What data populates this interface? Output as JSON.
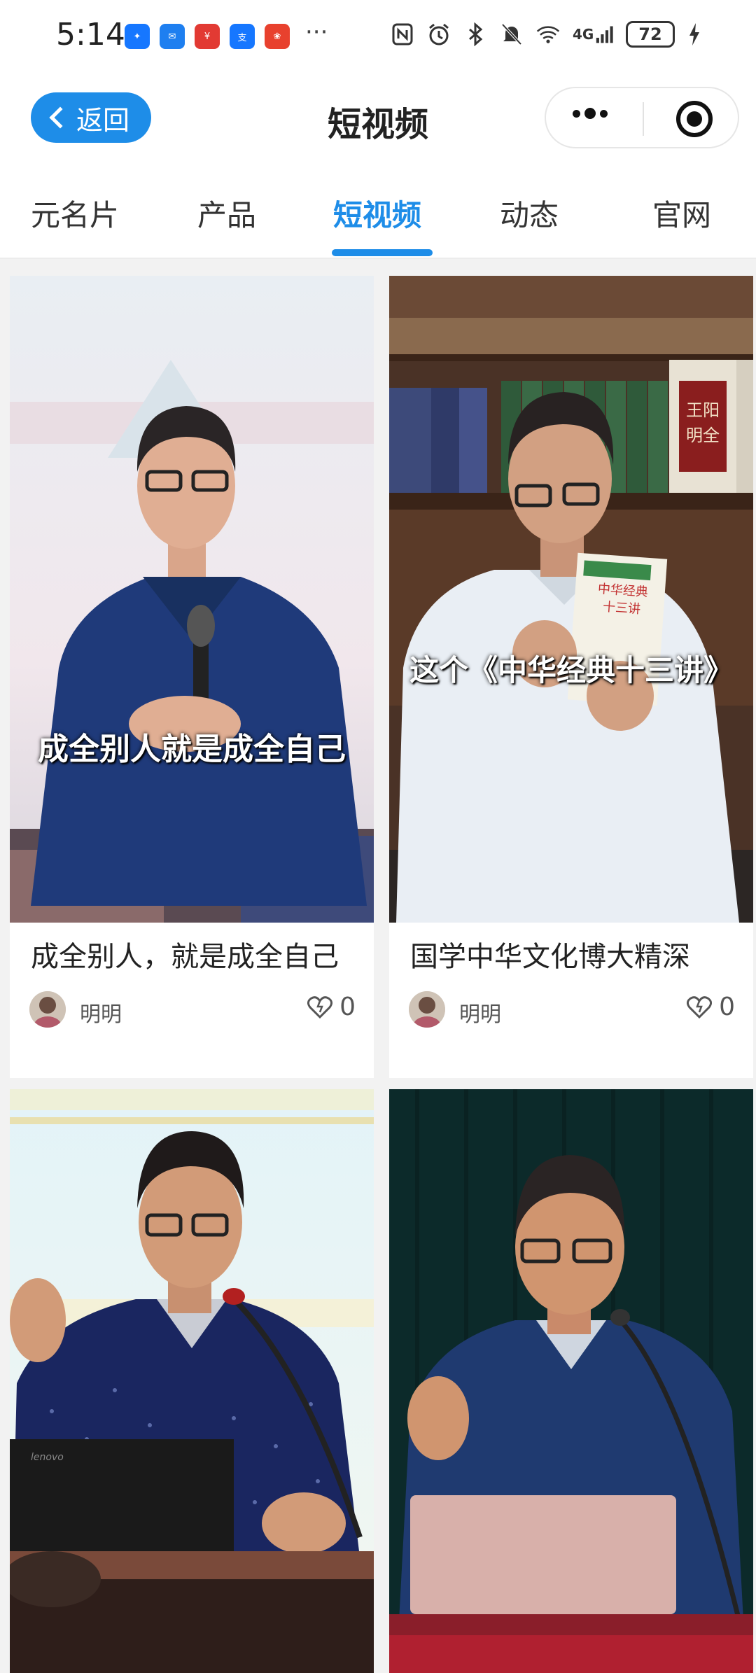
{
  "status_bar": {
    "time": "5:14",
    "apps": [
      {
        "icon": "message-app-icon",
        "color": "#1677ff"
      },
      {
        "icon": "mail-app-icon",
        "color": "#1e7ff0"
      },
      {
        "icon": "yunshanfu-app-icon",
        "color": "#e23a33"
      },
      {
        "icon": "alipay-app-icon",
        "color": "#1677ff"
      },
      {
        "icon": "huawei-app-icon",
        "color": "#e8412e"
      }
    ],
    "more": "···",
    "icons": [
      "nfc-icon",
      "alarm-icon",
      "bluetooth-icon",
      "mute-icon",
      "wifi-icon",
      "4g-signal-icon",
      "battery-icon",
      "charging-icon"
    ],
    "network": "4G",
    "battery": "72"
  },
  "header": {
    "back_label": "返回",
    "title": "短视频"
  },
  "tabs": [
    {
      "label": "元名片",
      "active": false
    },
    {
      "label": "产品",
      "active": false
    },
    {
      "label": "短视频",
      "active": true
    },
    {
      "label": "动态",
      "active": false
    },
    {
      "label": "官网",
      "active": false
    }
  ],
  "videos": [
    {
      "overlay": "成全别人就是成全自己",
      "title": "成全别人，就是成全自己",
      "author": "明明",
      "likes": "0"
    },
    {
      "overlay": "这个《中华经典十三讲》",
      "title": "国学中华文化博大精深",
      "author": "明明",
      "likes": "0"
    },
    {
      "overlay": "",
      "title": "",
      "author": "",
      "likes": ""
    },
    {
      "overlay": "",
      "title": "",
      "author": "",
      "likes": ""
    }
  ],
  "book_texts": {
    "shelf_book": "王阳明全集",
    "held_book": "中华经典十三讲"
  },
  "laptop_brand": "lenovo",
  "colors": {
    "accent": "#1e8de8",
    "background": "#f2f2f2"
  }
}
